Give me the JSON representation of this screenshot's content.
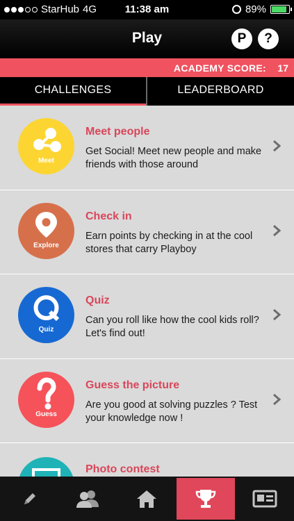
{
  "status_bar": {
    "carrier": "StarHub",
    "network": "4G",
    "time": "11:38 am",
    "battery": "89%",
    "battery_level": 0.89
  },
  "nav": {
    "title": "Play",
    "points_label": "P",
    "help_label": "?"
  },
  "score": {
    "label": "ACADEMY SCORE:",
    "value": "17"
  },
  "tabs": [
    {
      "label": "CHALLENGES"
    },
    {
      "label": "LEADERBOARD"
    }
  ],
  "challenges": [
    {
      "title": "Meet people",
      "description": "Get Social! Meet new people and make friends with those around",
      "icon_caption": "Meet",
      "icon": "people-network-icon",
      "color": "#fcd532"
    },
    {
      "title": "Check in",
      "description": "Earn points by checking in at the cool stores that carry Playboy",
      "icon_caption": "Explore",
      "icon": "location-pin-icon",
      "color": "#d6704b"
    },
    {
      "title": "Quiz",
      "description": "Can you roll like how the cool kids roll? Let's find out!",
      "icon_caption": "Quiz",
      "icon": "quiz-q-icon",
      "color": "#1669d3"
    },
    {
      "title": "Guess the picture",
      "description": "Are you good at solving puzzles ? Test your knowledge now !",
      "icon_caption": "Guess",
      "icon": "question-mark-icon",
      "color": "#f6525a"
    },
    {
      "title": "Photo contest",
      "description": "",
      "icon_caption": "",
      "icon": "photo-frame-icon",
      "color": "#1fb3b7"
    }
  ],
  "tab_bar": [
    {
      "name": "pencil-icon",
      "active": false
    },
    {
      "name": "friends-icon",
      "active": false
    },
    {
      "name": "home-icon",
      "active": false
    },
    {
      "name": "trophy-icon",
      "active": true
    },
    {
      "name": "news-card-icon",
      "active": false
    }
  ],
  "colors": {
    "accent": "#f05260",
    "title_pink": "#d9465a"
  }
}
